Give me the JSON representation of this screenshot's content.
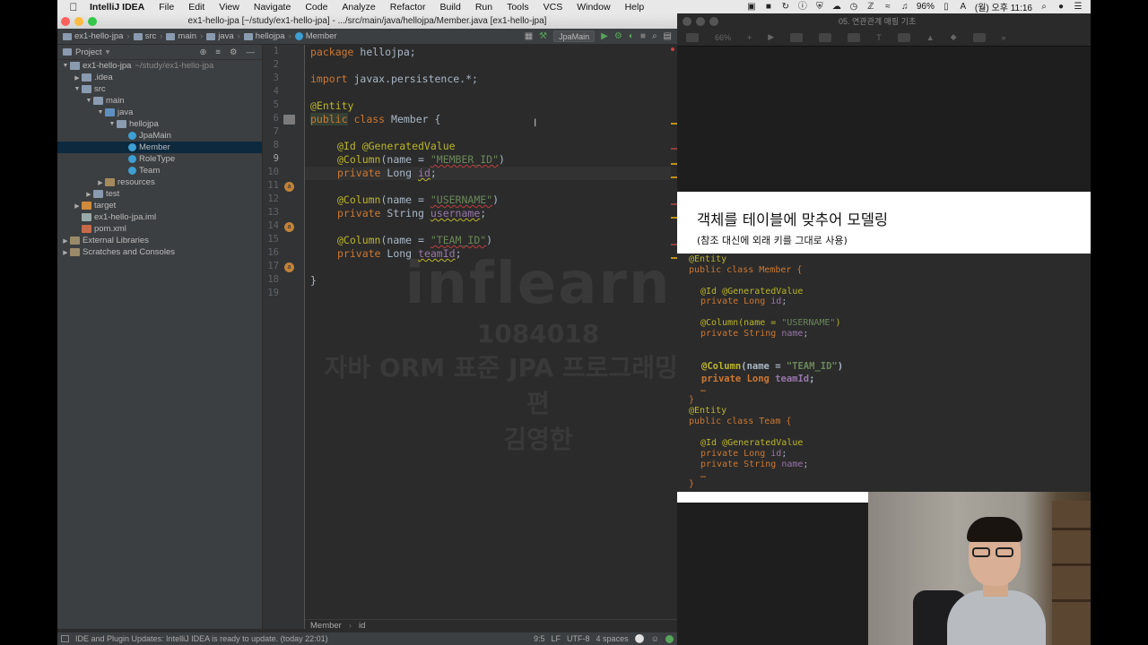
{
  "menubar": {
    "items": [
      "IntelliJ IDEA",
      "File",
      "Edit",
      "View",
      "Navigate",
      "Code",
      "Analyze",
      "Refactor",
      "Build",
      "Run",
      "Tools",
      "VCS",
      "Window",
      "Help"
    ],
    "battery": "96%",
    "clock": "(월) 오후 11:16"
  },
  "ide": {
    "window_title": "ex1-hello-jpa [~/study/ex1-hello-jpa] - .../src/main/java/hellojpa/Member.java [ex1-hello-jpa]",
    "breadcrumbs": [
      "ex1-hello-jpa",
      "src",
      "main",
      "java",
      "hellojpa",
      "Member"
    ],
    "run_config": "JpaMain",
    "project_panel": {
      "header": "Project",
      "tree": [
        {
          "label": "ex1-hello-jpa",
          "sub": "~/study/ex1-hello-jpa",
          "depth": 0,
          "arrow": "▼",
          "icon": "folder"
        },
        {
          "label": ".idea",
          "depth": 1,
          "arrow": "▶",
          "icon": "folder"
        },
        {
          "label": "src",
          "depth": 1,
          "arrow": "▼",
          "icon": "folder"
        },
        {
          "label": "main",
          "depth": 2,
          "arrow": "▼",
          "icon": "folder"
        },
        {
          "label": "java",
          "depth": 3,
          "arrow": "▼",
          "icon": "src"
        },
        {
          "label": "hellojpa",
          "depth": 4,
          "arrow": "▼",
          "icon": "folder"
        },
        {
          "label": "JpaMain",
          "depth": 5,
          "arrow": "",
          "icon": "class"
        },
        {
          "label": "Member",
          "depth": 5,
          "arrow": "",
          "icon": "class",
          "selected": true
        },
        {
          "label": "RoleType",
          "depth": 5,
          "arrow": "",
          "icon": "enum"
        },
        {
          "label": "Team",
          "depth": 5,
          "arrow": "",
          "icon": "class"
        },
        {
          "label": "resources",
          "depth": 3,
          "arrow": "▶",
          "icon": "res"
        },
        {
          "label": "test",
          "depth": 2,
          "arrow": "▶",
          "icon": "folder"
        },
        {
          "label": "target",
          "depth": 1,
          "arrow": "▶",
          "icon": "target"
        },
        {
          "label": "ex1-hello-jpa.iml",
          "depth": 1,
          "arrow": "",
          "icon": "file"
        },
        {
          "label": "pom.xml",
          "depth": 1,
          "arrow": "",
          "icon": "m"
        },
        {
          "label": "External Libraries",
          "depth": 0,
          "arrow": "▶",
          "icon": "lib"
        },
        {
          "label": "Scratches and Consoles",
          "depth": 0,
          "arrow": "▶",
          "icon": "lib"
        }
      ]
    },
    "line_numbers": [
      "1",
      "2",
      "3",
      "4",
      "5",
      "6",
      "7",
      "8",
      "9",
      "10",
      "11",
      "12",
      "13",
      "14",
      "15",
      "16",
      "17",
      "18",
      "19"
    ],
    "current_line": "9",
    "code": {
      "l1_kw": "package",
      "l1_rest": " hellojpa;",
      "l3_kw": "import",
      "l3_rest": " javax.persistence.*;",
      "l5": "@Entity",
      "l6_kw1": "public",
      "l6_kw2": " class",
      "l6_rest": " Member {",
      "l8": "@Id @GeneratedValue",
      "l9_ann": "@Column",
      "l9_mid": "(name = ",
      "l9_str": "\"MEMBER_ID\"",
      "l9_end": ")",
      "l10_kw": "private",
      "l10_type": " Long ",
      "l10_var": "id",
      "l10_end": ";",
      "l12_ann": "@Column",
      "l12_mid": "(name = ",
      "l12_str": "\"USERNAME\"",
      "l12_end": ")",
      "l13_kw": "private",
      "l13_type": " String ",
      "l13_var": "username",
      "l13_end": ";",
      "l15_ann": "@Column",
      "l15_mid": "(name = ",
      "l15_str": "\"TEAM_ID\"",
      "l15_end": ")",
      "l16_kw": "private",
      "l16_type": " Long ",
      "l16_var": "teamId",
      "l16_end": ";",
      "l18": "}"
    },
    "editor_breadcrumb": [
      "Member",
      "id"
    ],
    "status": {
      "message": "IDE and Plugin Updates: IntelliJ IDEA is ready to update. (today 22:01)",
      "position": "9:5",
      "line_sep": "LF",
      "encoding": "UTF-8",
      "indent": "4 spaces"
    }
  },
  "watermark": {
    "logo": "inflearn",
    "id": "1084018",
    "course": "자바 ORM 표준 JPA 프로그래밍 - 기본편",
    "author": "김영한"
  },
  "keynote": {
    "window_title": "05. 연관관계 매핑 기초",
    "zoom": "66%",
    "slide_title": "객체를 테이블에 맞추어 모델링",
    "slide_subtitle": "(참조 대신에 외래 키를 그대로 사용)",
    "code": {
      "c1": "@Entity",
      "c2": "public class Member {",
      "c3": "@Id @GeneratedValue",
      "c4_a": "private Long ",
      "c4_b": "id",
      "c4_c": ";",
      "c5_a": "@Column(name = ",
      "c5_b": "\"USERNAME\"",
      "c5_c": ")",
      "c6_a": "private String ",
      "c6_b": "name",
      "c6_c": ";",
      "c7_a": "@Column",
      "c7_b": "(name = ",
      "c7_c": "\"TEAM_ID\"",
      "c7_d": ")",
      "c8_a": "private Long ",
      "c8_b": "teamId",
      "c8_c": ";",
      "c9": "…",
      "c10": "}",
      "c11": "@Entity",
      "c12": "public class Team {",
      "c13": "@Id @GeneratedValue",
      "c14_a": "private Long ",
      "c14_b": "id",
      "c14_c": ";",
      "c15_a": "private String ",
      "c15_b": "name",
      "c15_c": ";",
      "c16": "…",
      "c17": "}"
    }
  }
}
